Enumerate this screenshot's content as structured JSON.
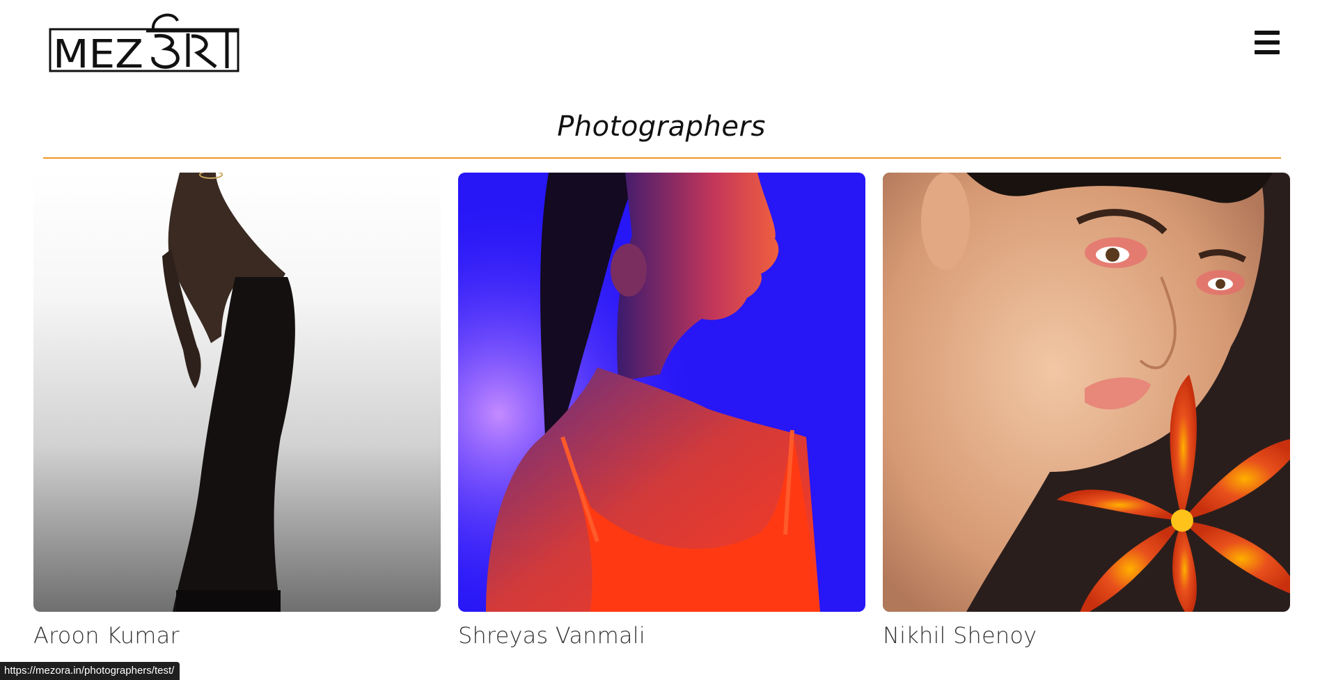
{
  "header": {
    "logo_text": "MEZओरा",
    "menu_icon": "hamburger-menu-icon"
  },
  "main": {
    "title": "Photographers",
    "divider_color": "#f29323",
    "cards": [
      {
        "name": "Aroon Kumar",
        "image": "model in dark trousers leaning back against white-to-grey gradient"
      },
      {
        "name": "Shreyas Vanmali",
        "image": "woman with eyes closed in red and blue neon light"
      },
      {
        "name": "Nikhil Shenoy",
        "image": "close-up beauty portrait of woman holding an orange lily"
      }
    ]
  },
  "status_bar": {
    "url": "https://mezora.in/photographers/test/"
  }
}
